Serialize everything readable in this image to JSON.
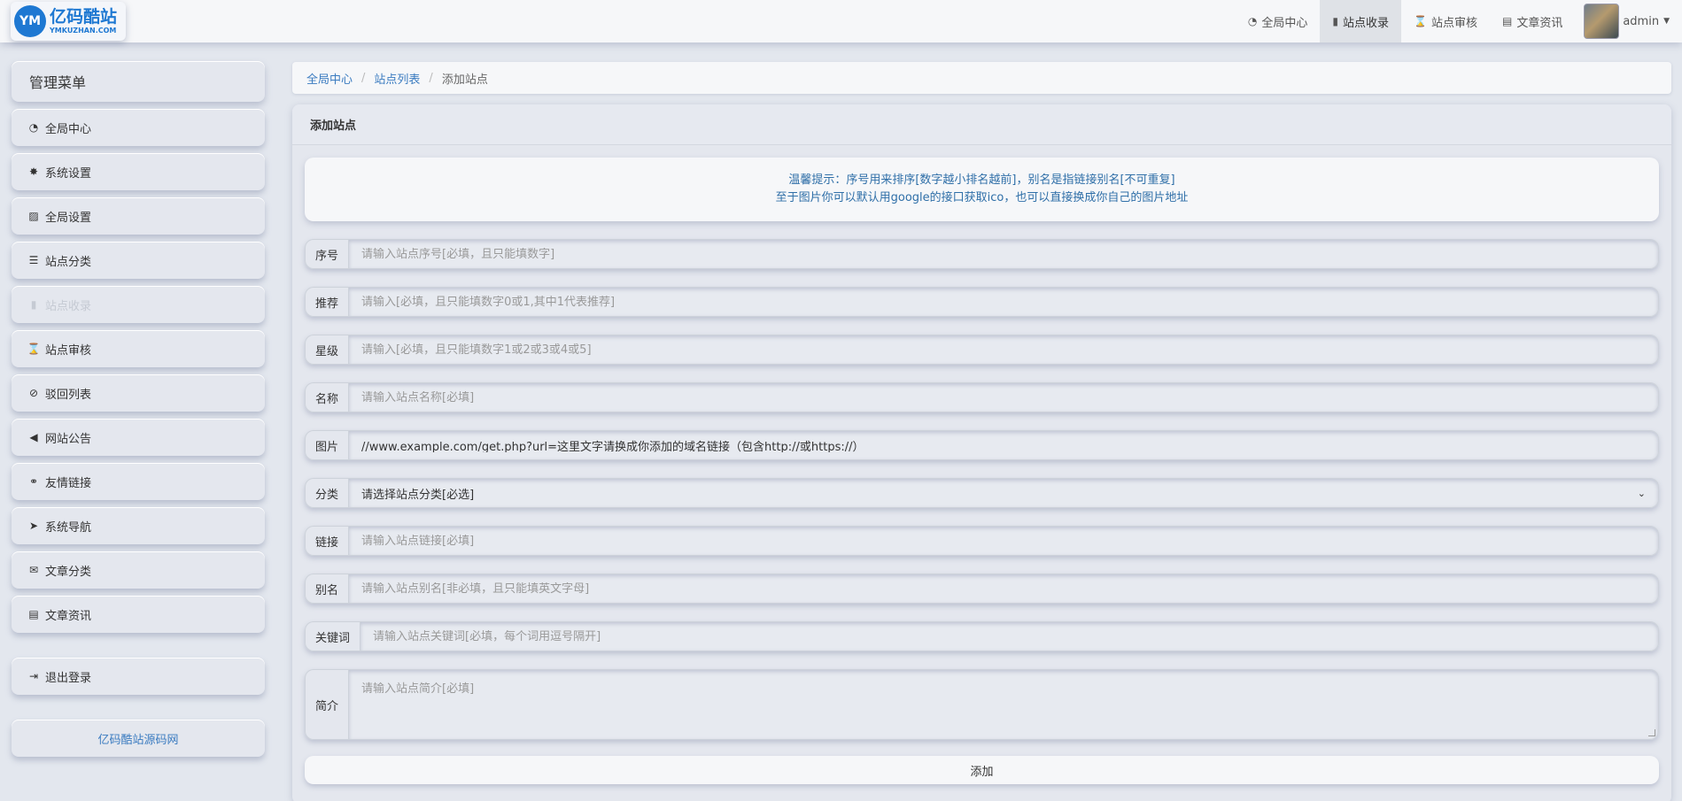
{
  "brand": {
    "logo_mark": "YM",
    "name_cn": "亿码酷站",
    "name_en": "YMKUZHAN.COM",
    "color": "#1e78d2"
  },
  "topnav": {
    "items": [
      {
        "label": "全局中心",
        "icon": "dashboard-icon",
        "active": false
      },
      {
        "label": "站点收录",
        "icon": "book-icon",
        "active": true
      },
      {
        "label": "站点审核",
        "icon": "hourglass-icon",
        "active": false
      },
      {
        "label": "文章资讯",
        "icon": "newspaper-icon",
        "active": false
      }
    ],
    "user": "admin"
  },
  "sidebar": {
    "title": "管理菜单",
    "items": [
      {
        "label": "全局中心",
        "icon": "dashboard-icon"
      },
      {
        "label": "系统设置",
        "icon": "gear-icon"
      },
      {
        "label": "全局设置",
        "icon": "image-icon"
      },
      {
        "label": "站点分类",
        "icon": "sliders-icon"
      },
      {
        "label": "站点收录",
        "icon": "book-icon"
      },
      {
        "label": "站点审核",
        "icon": "hourglass-icon"
      },
      {
        "label": "驳回列表",
        "icon": "ban-icon"
      },
      {
        "label": "网站公告",
        "icon": "megaphone-icon"
      },
      {
        "label": "友情链接",
        "icon": "handshake-icon"
      },
      {
        "label": "系统导航",
        "icon": "location-arrow-icon"
      },
      {
        "label": "文章分类",
        "icon": "envelope-icon"
      },
      {
        "label": "文章资讯",
        "icon": "newspaper-icon"
      }
    ],
    "logout": "退出登录",
    "footer": "亿码酷站源码网"
  },
  "breadcrumb": {
    "home": "全局中心",
    "list": "站点列表",
    "current": "添加站点"
  },
  "panel": {
    "title": "添加站点",
    "tip_line1": "温馨提示：序号用来排序[数字越小排名越前]，别名是指链接别名[不可重复]",
    "tip_line2": "至于图片你可以默认用google的接口获取ico，也可以直接换成你自己的图片地址"
  },
  "form": {
    "order": {
      "label": "序号",
      "placeholder": "请输入站点序号[必填，且只能填数字]"
    },
    "recommend": {
      "label": "推荐",
      "placeholder": "请输入[必填，且只能填数字0或1,其中1代表推荐]"
    },
    "star": {
      "label": "星级",
      "placeholder": "请输入[必填，且只能填数字1或2或3或4或5]"
    },
    "name": {
      "label": "名称",
      "placeholder": "请输入站点名称[必填]"
    },
    "image": {
      "label": "图片",
      "value": "//www.example.com/get.php?url=这里文字请换成你添加的域名链接（包含http://或https://）"
    },
    "category": {
      "label": "分类",
      "selected": "请选择站点分类[必选]"
    },
    "link": {
      "label": "链接",
      "placeholder": "请输入站点链接[必填]"
    },
    "alias": {
      "label": "别名",
      "placeholder": "请输入站点别名[非必填，且只能填英文字母]"
    },
    "keywords": {
      "label": "关键词",
      "placeholder": "请输入站点关键词[必填，每个词用逗号隔开]"
    },
    "intro": {
      "label": "简介",
      "placeholder": "请输入站点简介[必填]"
    },
    "submit": "添加"
  }
}
